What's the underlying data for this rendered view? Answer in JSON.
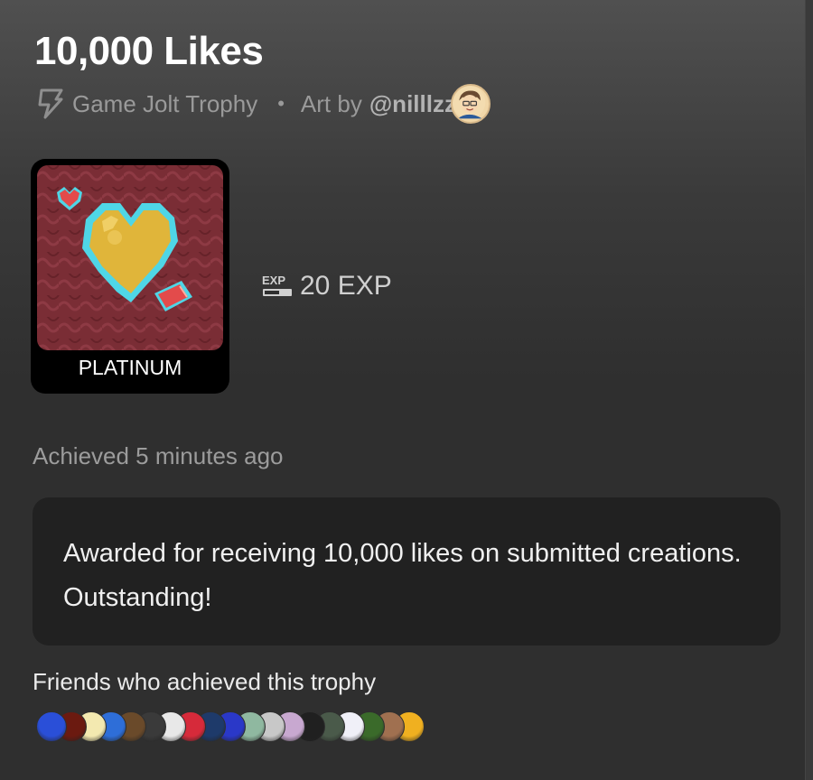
{
  "trophy": {
    "title": "10,000 Likes",
    "source": "Game Jolt Trophy",
    "separator": "•",
    "art_by_prefix": "Art by",
    "artist": "@nilllzz",
    "tier": "PLATINUM",
    "exp_icon_text": "EXP",
    "exp": "20 EXP",
    "achieved": "Achieved 5 minutes ago",
    "description": "Awarded for receiving 10,000 likes on submitted creations. Outstanding!"
  },
  "friends": {
    "label": "Friends who achieved this trophy",
    "avatar_colors": [
      "#2a4fd8",
      "#6b1a10",
      "#f3e9b0",
      "#2e6ed8",
      "#6a4a2a",
      "#3a3a3a",
      "#e8e8e8",
      "#d62a3a",
      "#1e3a6a",
      "#2a38c8",
      "#8fb8a0",
      "#c8c8c8",
      "#c8a8d0",
      "#202020",
      "#4a5a4a",
      "#f0f0f8",
      "#3a6a2a",
      "#a07050",
      "#f0b020"
    ]
  },
  "colors": {
    "background_top": "#505050",
    "background": "#2f2f2f",
    "description_box": "#212121",
    "muted_text": "#9a9a9a",
    "heart_gold": "#e0b53a",
    "heart_outline": "#4fd6e6",
    "art_background": "#7a2d35"
  },
  "icons": {
    "source_icon": "game-jolt-bolt-icon",
    "exp_icon": "exp-badge-icon"
  }
}
